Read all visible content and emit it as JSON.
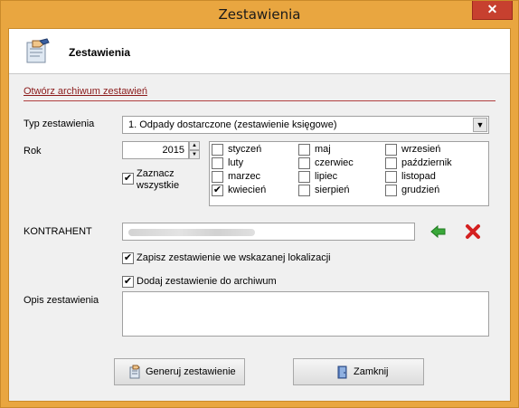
{
  "window": {
    "title": "Zestawienia",
    "close_glyph": "✕"
  },
  "header": {
    "title": "Zestawienia",
    "icon": "document-hand-icon"
  },
  "archive_link": "Otwórz archiwum zestawień",
  "type": {
    "label": "Typ zestawienia",
    "selected": "1.  Odpady dostarczone (zestawienie księgowe)",
    "arrow": "▼"
  },
  "year": {
    "label": "Rok",
    "value": "2015",
    "up": "▲",
    "down": "▼"
  },
  "select_all": {
    "label_line1": "Zaznacz",
    "label_line2": "wszystkie",
    "checked": true
  },
  "months": [
    {
      "name": "styczeń",
      "checked": false
    },
    {
      "name": "luty",
      "checked": false
    },
    {
      "name": "marzec",
      "checked": false
    },
    {
      "name": "kwiecień",
      "checked": true
    },
    {
      "name": "maj",
      "checked": false
    },
    {
      "name": "czerwiec",
      "checked": false
    },
    {
      "name": "lipiec",
      "checked": false
    },
    {
      "name": "sierpień",
      "checked": false
    },
    {
      "name": "wrzesień",
      "checked": false
    },
    {
      "name": "październik",
      "checked": false
    },
    {
      "name": "listopad",
      "checked": false
    },
    {
      "name": "grudzień",
      "checked": false
    }
  ],
  "contractor": {
    "label": "KONTRAHENT",
    "value": ""
  },
  "save_location": {
    "label": "Zapisz zestawienie we wskazanej lokalizacji",
    "checked": true
  },
  "add_archive": {
    "label": "Dodaj zestawienie do archiwum",
    "checked": true
  },
  "description": {
    "label": "Opis zestawienia",
    "value": ""
  },
  "buttons": {
    "generate": "Generuj zestawienie",
    "close": "Zamknij"
  },
  "check_glyph": "✔",
  "colors": {
    "frame": "#e9a640",
    "close": "#c7402f",
    "link": "#8b1a1a",
    "arrow_green": "#3aa83a",
    "delete_red": "#d42020"
  }
}
